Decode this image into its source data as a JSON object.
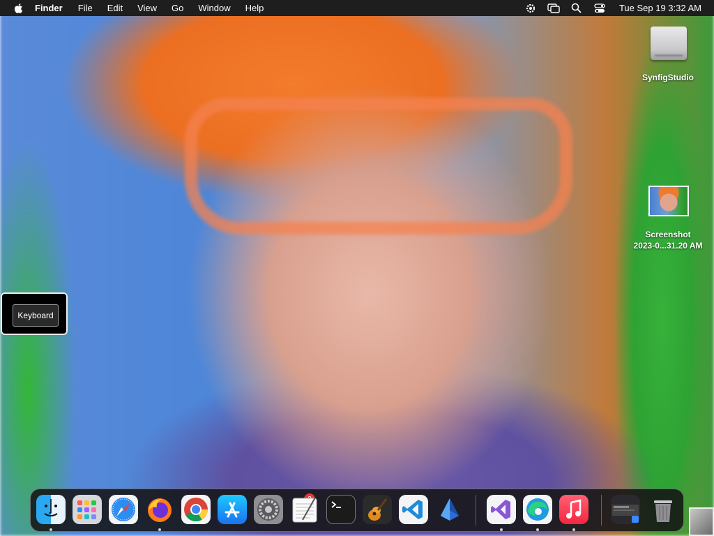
{
  "menubar": {
    "apple_icon": "apple-logo-icon",
    "app_name": "Finder",
    "menus": [
      "File",
      "Edit",
      "View",
      "Go",
      "Window",
      "Help"
    ],
    "status_icons": [
      "gear-icon",
      "screen-mirroring-icon",
      "spotlight-search-icon",
      "control-center-icon"
    ],
    "clock": "Tue Sep 19  3:32 AM"
  },
  "desktop": {
    "items": [
      {
        "label": "SynfigStudio",
        "icon": "hard-drive-icon"
      },
      {
        "label_line1": "Screenshot",
        "label_line2": "2023-0...31.20 AM",
        "icon": "screenshot-thumbnail-icon"
      }
    ]
  },
  "keyboard_popover": {
    "button_label": "Keyboard"
  },
  "dock": {
    "apps": [
      {
        "name": "Finder",
        "icon": "finder-icon",
        "running": true
      },
      {
        "name": "Launchpad",
        "icon": "launchpad-icon",
        "running": false
      },
      {
        "name": "Safari",
        "icon": "safari-icon",
        "running": false
      },
      {
        "name": "Firefox",
        "icon": "firefox-icon",
        "running": true
      },
      {
        "name": "Google Chrome",
        "icon": "chrome-icon",
        "running": false
      },
      {
        "name": "App Store",
        "icon": "app-store-icon",
        "running": false
      },
      {
        "name": "System Preferences",
        "icon": "system-preferences-icon",
        "running": false,
        "badge": "2"
      },
      {
        "name": "TextEdit",
        "icon": "textedit-icon",
        "running": false
      },
      {
        "name": "Terminal",
        "icon": "terminal-icon",
        "running": false
      },
      {
        "name": "GarageBand",
        "icon": "garageband-icon",
        "running": false
      },
      {
        "name": "Visual Studio Code",
        "icon": "vscode-icon",
        "running": false
      },
      {
        "name": "Xcode Instruments",
        "icon": "blue-crystal-icon",
        "running": false
      },
      {
        "name": "Visual Studio",
        "icon": "visual-studio-icon",
        "running": true
      },
      {
        "name": "Microsoft Edge",
        "icon": "edge-icon",
        "running": true
      },
      {
        "name": "Music",
        "icon": "music-icon",
        "running": true
      }
    ],
    "downloads_stack": "downloads-stack-icon",
    "trash": "trash-icon"
  }
}
